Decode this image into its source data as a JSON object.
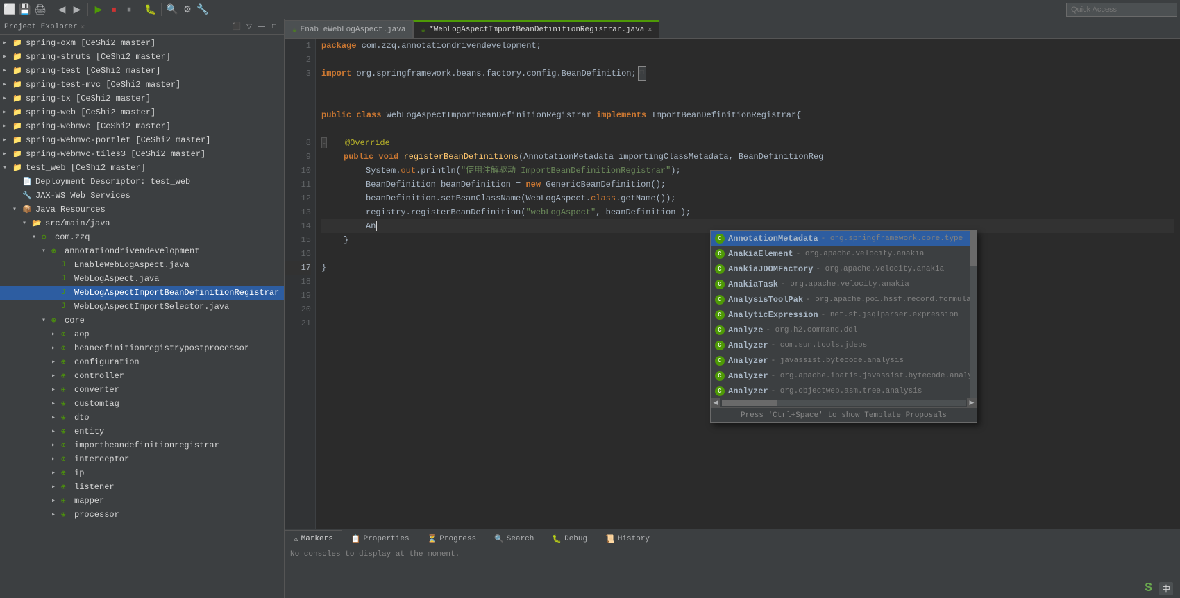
{
  "toolbar": {
    "quick_access_placeholder": "Quick Access",
    "buttons": [
      "💾",
      "🔧",
      "⚙",
      "▶",
      "⏹",
      "⏸",
      "⏭",
      "🔍",
      "🐛",
      "📋"
    ]
  },
  "project_explorer": {
    "title": "Project Explorer",
    "items": [
      {
        "id": "spring-oxm",
        "label": "spring-oxm [CeShi2 master]",
        "level": 0,
        "type": "project",
        "expanded": false
      },
      {
        "id": "spring-struts",
        "label": "spring-struts [CeShi2 master]",
        "level": 0,
        "type": "project",
        "expanded": false
      },
      {
        "id": "spring-test",
        "label": "spring-test [CeShi2 master]",
        "level": 0,
        "type": "project",
        "expanded": false
      },
      {
        "id": "spring-test-mvc",
        "label": "spring-test-mvc [CeShi2 master]",
        "level": 0,
        "type": "project",
        "expanded": false
      },
      {
        "id": "spring-tx",
        "label": "spring-tx [CeShi2 master]",
        "level": 0,
        "type": "project",
        "expanded": false
      },
      {
        "id": "spring-web",
        "label": "spring-web [CeShi2 master]",
        "level": 0,
        "type": "project",
        "expanded": false
      },
      {
        "id": "spring-webmvc",
        "label": "spring-webmvc [CeShi2 master]",
        "level": 0,
        "type": "project",
        "expanded": false
      },
      {
        "id": "spring-webmvc-portlet",
        "label": "spring-webmvc-portlet [CeShi2 master]",
        "level": 0,
        "type": "project",
        "expanded": false
      },
      {
        "id": "spring-webmvc-tiles3",
        "label": "spring-webmvc-tiles3 [CeShi2 master]",
        "level": 0,
        "type": "project",
        "expanded": false
      },
      {
        "id": "test_web",
        "label": "test_web [CeShi2 master]",
        "level": 0,
        "type": "project",
        "expanded": true
      },
      {
        "id": "deployment-descriptor",
        "label": "Deployment Descriptor: test_web",
        "level": 1,
        "type": "descriptor"
      },
      {
        "id": "jax-ws",
        "label": "JAX-WS Web Services",
        "level": 1,
        "type": "service"
      },
      {
        "id": "java-resources",
        "label": "Java Resources",
        "level": 1,
        "type": "resources",
        "expanded": true
      },
      {
        "id": "src-main-java",
        "label": "src/main/java",
        "level": 2,
        "type": "folder",
        "expanded": true
      },
      {
        "id": "com-zzq",
        "label": "com.zzq",
        "level": 3,
        "type": "package",
        "expanded": true
      },
      {
        "id": "annotationdrivendevelopment",
        "label": "annotationdrivendevelopment",
        "level": 4,
        "type": "package",
        "expanded": true
      },
      {
        "id": "EnableWebLogAspect",
        "label": "EnableWebLogAspect.java",
        "level": 5,
        "type": "java"
      },
      {
        "id": "WebLogAspect",
        "label": "WebLogAspect.java",
        "level": 5,
        "type": "java"
      },
      {
        "id": "WebLogAspectImportBeanDefinitionRegistrar",
        "label": "WebLogAspectImportBeanDefinitionRegistrar",
        "level": 5,
        "type": "java",
        "active": true
      },
      {
        "id": "WebLogAspectImportSelector",
        "label": "WebLogAspectImportSelector.java",
        "level": 5,
        "type": "java"
      },
      {
        "id": "core",
        "label": "core",
        "level": 4,
        "type": "package",
        "expanded": true
      },
      {
        "id": "aop",
        "label": "aop",
        "level": 5,
        "type": "package"
      },
      {
        "id": "beaneefinitionregistrypostprocessor",
        "label": "beaneefinitionregistrypostprocessor",
        "level": 5,
        "type": "package"
      },
      {
        "id": "configuration",
        "label": "configuration",
        "level": 5,
        "type": "package"
      },
      {
        "id": "controller",
        "label": "controller",
        "level": 5,
        "type": "package"
      },
      {
        "id": "converter",
        "label": "converter",
        "level": 5,
        "type": "package"
      },
      {
        "id": "customtag",
        "label": "customtag",
        "level": 5,
        "type": "package"
      },
      {
        "id": "dto",
        "label": "dto",
        "level": 5,
        "type": "package"
      },
      {
        "id": "entity",
        "label": "entity",
        "level": 5,
        "type": "package"
      },
      {
        "id": "importbeandefinitionregistrar",
        "label": "importbeandefinitionregistrar",
        "level": 5,
        "type": "package"
      },
      {
        "id": "interceptor",
        "label": "interceptor",
        "level": 5,
        "type": "package"
      },
      {
        "id": "ip",
        "label": "ip",
        "level": 5,
        "type": "package"
      },
      {
        "id": "listener",
        "label": "listener",
        "level": 5,
        "type": "package"
      },
      {
        "id": "mapper",
        "label": "mapper",
        "level": 5,
        "type": "package"
      },
      {
        "id": "processor",
        "label": "processor",
        "level": 5,
        "type": "package"
      }
    ]
  },
  "editor": {
    "tabs": [
      {
        "id": "EnableWebLogAspect",
        "label": "EnableWebLogAspect.java",
        "active": false,
        "modified": false
      },
      {
        "id": "WebLogAspectImportBeanDefinitionRegistrar",
        "label": "*WebLogAspectImportBeanDefinitionRegistrar.java",
        "active": true,
        "modified": true
      }
    ],
    "lines": [
      {
        "num": 1,
        "content": "package_com_zzq_annotationdrivendevelopment"
      },
      {
        "num": 2,
        "content": "blank"
      },
      {
        "num": 3,
        "content": "import_spring_beans"
      },
      {
        "num": 8,
        "content": "blank"
      },
      {
        "num": 9,
        "content": "public_class_decl"
      },
      {
        "num": 10,
        "content": "blank"
      },
      {
        "num": 11,
        "content": "override"
      },
      {
        "num": 12,
        "content": "register_method"
      },
      {
        "num": 13,
        "content": "system_out"
      },
      {
        "num": 14,
        "content": "bean_definition"
      },
      {
        "num": 15,
        "content": "set_bean_classname"
      },
      {
        "num": 16,
        "content": "registry_register"
      },
      {
        "num": 17,
        "content": "an_cursor"
      },
      {
        "num": 18,
        "content": "close_brace"
      },
      {
        "num": 19,
        "content": "blank"
      },
      {
        "num": 20,
        "content": "close_brace"
      },
      {
        "num": 21,
        "content": "blank"
      }
    ]
  },
  "autocomplete": {
    "items": [
      {
        "name": "AnnotationMetadata",
        "pkg": "org.springframework.core.type",
        "type": "class"
      },
      {
        "name": "AnakiaElement",
        "pkg": "org.apache.velocity.anakia",
        "type": "class"
      },
      {
        "name": "AnakiaJDOMFactory",
        "pkg": "org.apache.velocity.anakia",
        "type": "class"
      },
      {
        "name": "AnakiaTask",
        "pkg": "org.apache.velocity.anakia",
        "type": "class"
      },
      {
        "name": "AnalysisToolPak",
        "pkg": "org.apache.poi.hssf.record.formula.atp",
        "type": "class"
      },
      {
        "name": "AnalyticExpression",
        "pkg": "net.sf.jsqlparser.expression",
        "type": "class"
      },
      {
        "name": "Analyze",
        "pkg": "org.h2.command.ddl",
        "type": "class"
      },
      {
        "name": "Analyzer",
        "pkg": "com.sun.tools.jdeps",
        "type": "class"
      },
      {
        "name": "Analyzer",
        "pkg": "javassist.bytecode.analysis",
        "type": "class"
      },
      {
        "name": "Analyzer",
        "pkg": "org.apache.ibatis.javassist.bytecode.analysis",
        "type": "class"
      },
      {
        "name": "Analyzer",
        "pkg": "org.objectweb.asm.tree.analysis",
        "type": "class"
      }
    ],
    "hint": "Press 'Ctrl+Space' to show Template Proposals"
  },
  "bottom_panels": {
    "tabs": [
      {
        "id": "markers",
        "label": "Markers",
        "icon": "⚠"
      },
      {
        "id": "properties",
        "label": "Properties",
        "icon": "📋"
      },
      {
        "id": "progress",
        "label": "Progress",
        "icon": "⏳"
      },
      {
        "id": "search",
        "label": "Search",
        "icon": "🔍"
      },
      {
        "id": "debug",
        "label": "Debug",
        "icon": "🐛"
      },
      {
        "id": "history",
        "label": "History",
        "icon": "📜"
      }
    ],
    "active_tab": "markers",
    "content": "No consoles to display at the moment."
  },
  "status_bar": {
    "logo": "S",
    "lang": "中"
  }
}
